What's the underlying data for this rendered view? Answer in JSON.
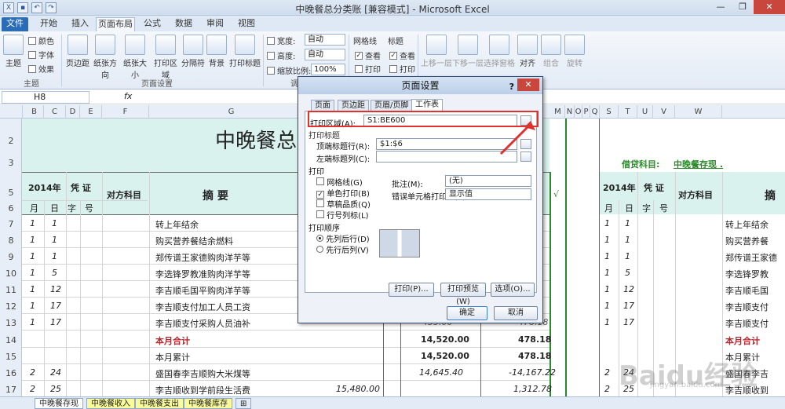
{
  "window": {
    "title": "中晚餐总分类账 [兼容模式] - Microsoft Excel"
  },
  "ribbon_tabs": [
    "文件",
    "开始",
    "插入",
    "页面布局",
    "公式",
    "数据",
    "审阅",
    "视图"
  ],
  "ribbon": {
    "theme": {
      "big": "主题",
      "colors": "颜色",
      "fonts": "字体",
      "effects": "效果",
      "group": "主题"
    },
    "page_setup": {
      "margins": "页边距",
      "orientation": "纸张方向",
      "size": "纸张大小",
      "print_area": "打印区域",
      "breaks": "分隔符",
      "background": "背景",
      "print_titles": "打印标题",
      "group": "页面设置"
    },
    "scale": {
      "width_label": "宽度:",
      "width_value": "自动",
      "height_label": "高度:",
      "height_value": "自动",
      "scale_label": "缩放比例:",
      "scale_value": "100%",
      "group": "调整为"
    },
    "sheet_options": {
      "gridlines": "网格线",
      "headings": "标题",
      "view": "查看",
      "print": "打印"
    },
    "arrange": {
      "bring_forward": "上移一层",
      "send_backward": "下移一层",
      "selection_pane": "选择窗格",
      "align": "对齐",
      "group_btn": "组合",
      "rotate": "旋转"
    }
  },
  "namebox": "H8",
  "fx": "fx",
  "columns": [
    "B",
    "C",
    "D",
    "E",
    "F",
    "G",
    "M",
    "N",
    "O",
    "P",
    "Q",
    "S",
    "T",
    "U",
    "V",
    "W"
  ],
  "rows": [
    "2",
    "3",
    "5",
    "6",
    "7",
    "8",
    "9",
    "10",
    "11",
    "12",
    "13",
    "14",
    "15",
    "16",
    "17"
  ],
  "sheet": {
    "title": "中晚餐总",
    "right_header": "借贷科目:",
    "right_header_value": "中晚餐存现 .",
    "year": "2014年",
    "voucher": "凭  证",
    "account": "对方科目",
    "summary": "摘          要",
    "summary_right": "摘",
    "month": "月",
    "day": "日",
    "type": "字",
    "num": "号",
    "check": "√",
    "rows": [
      {
        "m": "1",
        "d": "1",
        "desc": "转上年结余",
        "amt": "",
        "bal": ""
      },
      {
        "m": "1",
        "d": "1",
        "desc": "购买营养餐结余燃料",
        "amt": "",
        "bal": ""
      },
      {
        "m": "1",
        "d": "1",
        "desc": "郑传谱王家德购肉洋芋等",
        "amt": "",
        "bal": ""
      },
      {
        "m": "1",
        "d": "5",
        "desc": "李选锋罗教准购肉洋芋等",
        "amt": "",
        "bal": ""
      },
      {
        "m": "1",
        "d": "12",
        "desc": "李吉顺毛国平购肉洋芋等",
        "amt": "",
        "bal": ""
      },
      {
        "m": "1",
        "d": "17",
        "desc": "李吉顺支付加工人员工资",
        "amt": "",
        "bal": ""
      },
      {
        "m": "1",
        "d": "17",
        "desc": "李吉顺支付采购人员油补",
        "amt": "435.00",
        "bal": "478.18"
      },
      {
        "m": "",
        "d": "",
        "desc": "本月合计",
        "amt": "14,520.00",
        "bal": "478.18"
      },
      {
        "m": "",
        "d": "",
        "desc": "本月累计",
        "amt": "14,520.00",
        "bal": "478.18"
      },
      {
        "m": "2",
        "d": "24",
        "desc": "盛国春李吉顺购大米煤等",
        "amt": "14,645.40",
        "bal": "-14,167.22"
      },
      {
        "m": "2",
        "d": "25",
        "desc": "李吉顺收到学前段生活费",
        "debit": "15,480.00",
        "bal": "1,312.78"
      }
    ],
    "right_rows": [
      {
        "m": "1",
        "d": "1",
        "desc": "转上年结余"
      },
      {
        "m": "1",
        "d": "1",
        "desc": "购买营养餐"
      },
      {
        "m": "1",
        "d": "1",
        "desc": "郑传谱王家德"
      },
      {
        "m": "1",
        "d": "5",
        "desc": "李选锋罗教"
      },
      {
        "m": "1",
        "d": "12",
        "desc": "李吉顺毛国"
      },
      {
        "m": "1",
        "d": "17",
        "desc": "李吉顺支付"
      },
      {
        "m": "1",
        "d": "17",
        "desc": "李吉顺支付"
      },
      {
        "m": "",
        "d": "",
        "desc": "本月合计"
      },
      {
        "m": "",
        "d": "",
        "desc": "本月累计"
      },
      {
        "m": "2",
        "d": "24",
        "desc": "盛国春李吉"
      },
      {
        "m": "2",
        "d": "25",
        "desc": "李吉顺收到"
      }
    ]
  },
  "sheet_tabs": [
    "中晚餐存现",
    "中晚餐收入",
    "中晚餐支出",
    "中晚餐库存"
  ],
  "dialog": {
    "title": "页面设置",
    "help": "?",
    "tabs": [
      "页面",
      "页边距",
      "页眉/页脚",
      "工作表"
    ],
    "print_area_label": "打印区域(A):",
    "print_area_value": "S1:BE600",
    "print_titles": "打印标题",
    "top_rows_label": "顶端标题行(R):",
    "top_rows_value": "$1:$6",
    "left_cols_label": "左端标题列(C):",
    "print_section": "打印",
    "gridlines": "网格线(G)",
    "bw": "单色打印(B)",
    "draft": "草稿品质(Q)",
    "row_col": "行号列标(L)",
    "comments_label": "批注(M):",
    "comments_value": "(无)",
    "errors_label": "错误单元格打印为(E):",
    "errors_value": "显示值",
    "order_section": "打印顺序",
    "down_then_over": "先列后行(D)",
    "over_then_down": "先行后列(V)",
    "btn_print": "打印(P)...",
    "btn_preview": "打印预览(W)",
    "btn_options": "选项(O)...",
    "btn_ok": "确定",
    "btn_cancel": "取消"
  },
  "watermark": "Baidu经验",
  "watermark_sub": "jingyan.baidu.com"
}
